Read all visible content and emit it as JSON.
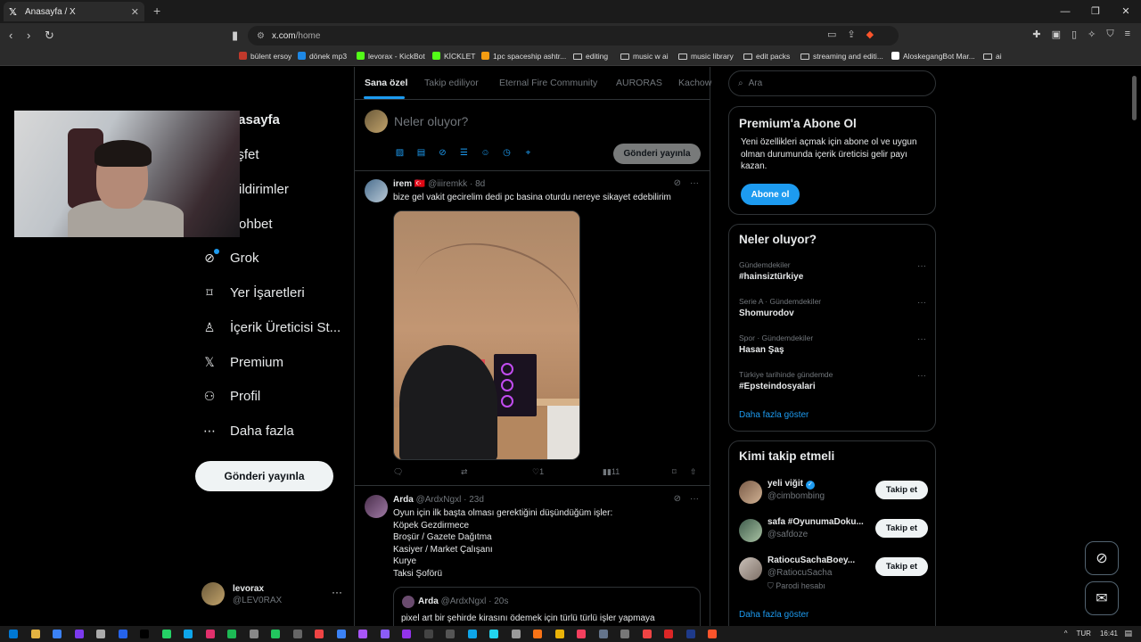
{
  "browser": {
    "tab_title": "Anasayfa / X",
    "url_host": "x.com",
    "url_path": "/home",
    "bookmarks": [
      {
        "label": "bülent ersoy",
        "type": "site",
        "color": "#c0392b"
      },
      {
        "label": "dönek mp3",
        "type": "site",
        "color": "#1e88e5"
      },
      {
        "label": "levorax - KickBot",
        "type": "site",
        "color": "#53fc18"
      },
      {
        "label": "KİCKLET",
        "type": "site",
        "color": "#53fc18"
      },
      {
        "label": "1pc spaceship ashtr...",
        "type": "site",
        "color": "#f39c12"
      },
      {
        "label": "editing",
        "type": "folder"
      },
      {
        "label": "music w ai",
        "type": "folder"
      },
      {
        "label": "music library",
        "type": "folder"
      },
      {
        "label": "edit packs",
        "type": "folder"
      },
      {
        "label": "streaming and editi...",
        "type": "folder"
      },
      {
        "label": "AloskegangBot Mar...",
        "type": "site",
        "color": "#ffffff"
      },
      {
        "label": "ai",
        "type": "folder"
      }
    ]
  },
  "nav": {
    "partial_home": "nasayfa",
    "partial_explore": "eşfet",
    "items": [
      {
        "label": "Bildirimler",
        "icon": "bell-icon",
        "glyph": "🔔︎"
      },
      {
        "label": "Sohbet",
        "icon": "envelope-icon",
        "glyph": "✉"
      },
      {
        "label": "Grok",
        "icon": "grok-icon",
        "glyph": "⊘"
      },
      {
        "label": "Yer İşaretleri",
        "icon": "bookmark-icon",
        "glyph": "⌑"
      },
      {
        "label": "İçerik Üreticisi St...",
        "icon": "creator-studio-icon",
        "glyph": "♙"
      },
      {
        "label": "Premium",
        "icon": "x-logo-icon",
        "glyph": "𝕏"
      },
      {
        "label": "Profil",
        "icon": "person-icon",
        "glyph": "⚇"
      },
      {
        "label": "Daha fazla",
        "icon": "more-circle-icon",
        "glyph": "⋯"
      }
    ],
    "post_button": "Gönderi yayınla",
    "account_name": "levorax",
    "account_handle": "@LEV0RAX"
  },
  "feed": {
    "tabs": [
      "Sana özel",
      "Takip ediliyor",
      "Eternal Fire Community",
      "AURORAS",
      "Kachow"
    ],
    "compose_placeholder": "Neler oluyor?",
    "compose_button": "Gönderi yayınla",
    "tweets": [
      {
        "name": "irem",
        "flag": "🇹🇷",
        "handle": "@iiiremkk",
        "time": "8d",
        "text": "bize gel vakit gecirelim dedi pc basina oturdu nereye sikayet edebilirim",
        "likes": "1",
        "views": "11"
      },
      {
        "name": "Arda",
        "handle": "@ArdxNgxl",
        "time": "23d",
        "text": "Oyun için ilk başta olması gerektiğini düşündüğüm işler:\nKöpek Gezdirmece\nBroşür / Gazete Dağıtma\nKasiyer / Market Çalışanı\nKurye\nTaksi Şoförü",
        "quote": {
          "name": "Arda",
          "handle": "@ArdxNgxl",
          "time": "20s",
          "text": "pixel art bir şehirde kirasını ödemek için türlü türlü işler yapmaya"
        }
      }
    ]
  },
  "sidebar": {
    "search_placeholder": "Ara",
    "premium": {
      "title": "Premium'a Abone Ol",
      "body": "Yeni özellikleri açmak için abone ol ve uygun olman durumunda içerik üreticisi gelir payı kazan.",
      "button": "Abone ol"
    },
    "trends": {
      "title": "Neler oluyor?",
      "items": [
        {
          "context": "Gündemdekiler",
          "name": "#hainsiztürkiye"
        },
        {
          "context": "Serie A · Gündemdekiler",
          "name": "Shomurodov"
        },
        {
          "context": "Spor · Gündemdekiler",
          "name": "Hasan Şaş"
        },
        {
          "context": "Türkiye tarihinde gündemde",
          "name": "#Epsteindosyalari"
        }
      ],
      "show_more": "Daha fazla göster"
    },
    "who_to_follow": {
      "title": "Kimi takip etmeli",
      "items": [
        {
          "name": "yeli viğit",
          "handle": "@cimbombing",
          "verified": true,
          "extra": ""
        },
        {
          "name": "safa #OyunumaDoku...",
          "handle": "@safdoze",
          "verified": false,
          "extra": ""
        },
        {
          "name": "RatiocuSachaBoey...",
          "handle": "@RatiocuSacha",
          "verified": false,
          "extra": "Parodi hesabı"
        }
      ],
      "follow_label": "Takip et",
      "show_more": "Daha fazla göster"
    }
  },
  "taskbar": {
    "lang": "TUR",
    "time": "16:41"
  },
  "colors": {
    "accent": "#1d9bf0",
    "background": "#000000",
    "border": "#2f3336",
    "muted": "#71767b"
  }
}
